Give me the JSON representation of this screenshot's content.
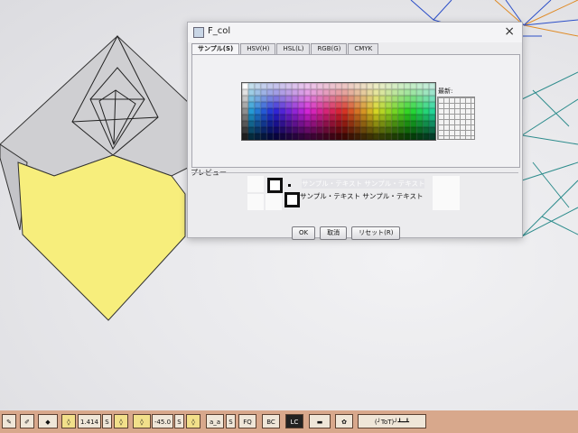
{
  "dialog": {
    "title": "F_col",
    "close_label": "×",
    "tabs": [
      {
        "label": "サンプル(S)",
        "active": true
      },
      {
        "label": "HSV(H)",
        "active": false
      },
      {
        "label": "HSL(L)",
        "active": false
      },
      {
        "label": "RGB(G)",
        "active": false
      },
      {
        "label": "CMYK",
        "active": false
      }
    ],
    "recent_label": "最新:",
    "preview_label": "プレビュー",
    "preview_text_1": "サンプル・テキスト サンプル・テキスト",
    "preview_text_2": "サンプル・テキスト サンプル・テキスト",
    "buttons": {
      "ok": "OK",
      "cancel": "取消",
      "reset": "リセット(R)"
    }
  },
  "toolbar": {
    "zoom_value": "1.414",
    "s_label": "S",
    "angle_value": "-45.0",
    "aa_label": "a_a",
    "fq_label": "FQ",
    "bc_label": "BC",
    "lc_label": "LC",
    "face_label": "(╯ToT)╯┻━┻"
  },
  "colors": {
    "paper_yellow": "#f7ee7c",
    "paper_grey": "#cfcfd2",
    "crease_blue": "#2c4fc8",
    "crease_orange": "#e08a24",
    "crease_teal": "#2d8c8c",
    "toolbar_bg": "#d8a88c"
  }
}
